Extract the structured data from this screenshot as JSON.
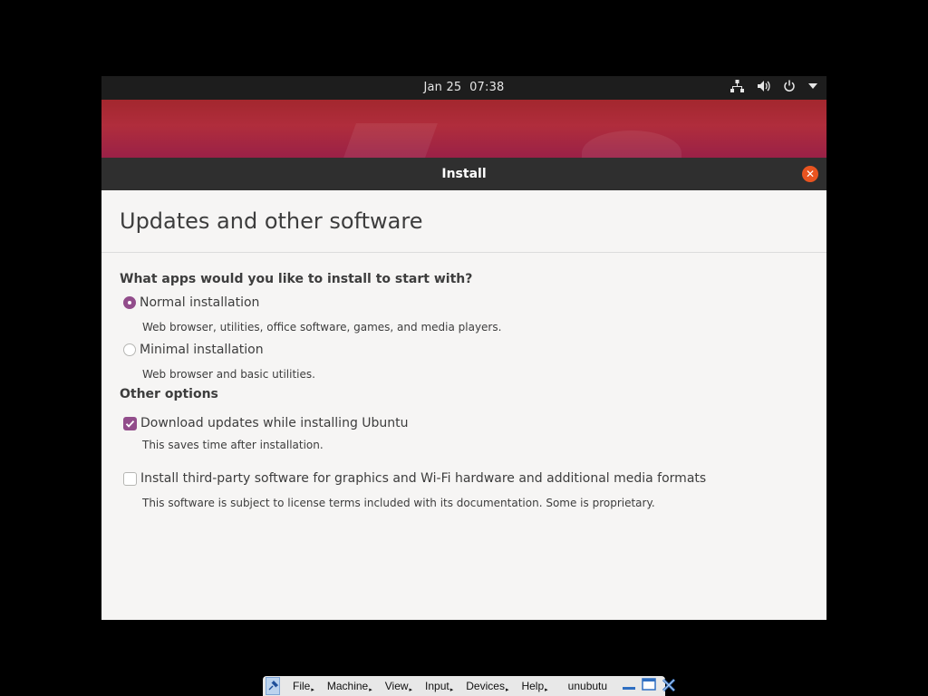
{
  "topbar": {
    "date": "Jan 25",
    "time": "07:38",
    "icons": [
      "network-icon",
      "volume-icon",
      "power-icon",
      "dropdown-arrow-icon"
    ]
  },
  "window": {
    "title": "Install"
  },
  "page": {
    "heading": "Updates and other software",
    "question": "What apps would you like to install to start with?",
    "install_options": [
      {
        "label": "Normal installation",
        "description": "Web browser, utilities, office software, games, and media players.",
        "selected": true
      },
      {
        "label": "Minimal installation",
        "description": "Web browser and basic utilities.",
        "selected": false
      }
    ],
    "other_options_heading": "Other options",
    "other_options": [
      {
        "label": "Download updates while installing Ubuntu",
        "description": "This saves time after installation.",
        "checked": true
      },
      {
        "label": "Install third-party software for graphics and Wi-Fi hardware and additional media formats",
        "description": "This software is subject to license terms included with its documentation. Some is proprietary.",
        "checked": false
      }
    ]
  },
  "vbox_bar": {
    "menus": [
      "File",
      "Machine",
      "View",
      "Input",
      "Devices",
      "Help"
    ],
    "vm_name": "unubutu"
  },
  "colors": {
    "accent": "#924d8b",
    "close": "#e95420",
    "titlebar": "#2f2f2f"
  }
}
